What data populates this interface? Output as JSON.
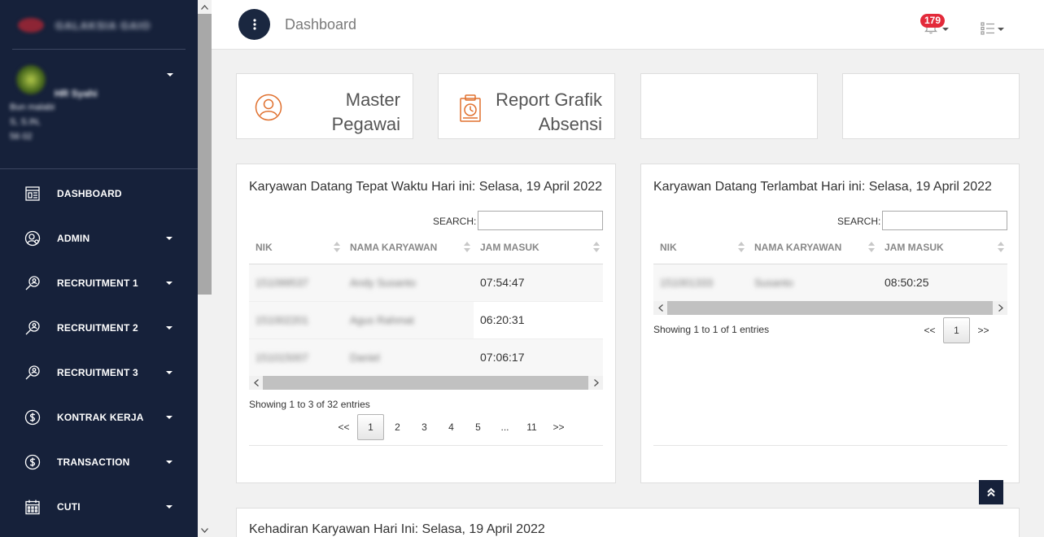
{
  "sidebar": {
    "brand": "GALAKSIA GAIO",
    "profile": {
      "name": "HR Syahi",
      "lines": [
        "Bun malabi",
        "S, S.IN,",
        "56 02"
      ]
    },
    "menu": [
      {
        "label": "DASHBOARD",
        "icon": "dashboard-icon",
        "has_caret": false
      },
      {
        "label": "ADMIN",
        "icon": "user-gear-icon",
        "has_caret": true
      },
      {
        "label": "RECRUITMENT 1",
        "icon": "search-user-icon",
        "has_caret": true
      },
      {
        "label": "RECRUITMENT 2",
        "icon": "search-user-icon",
        "has_caret": true
      },
      {
        "label": "RECRUITMENT 3",
        "icon": "search-user-icon",
        "has_caret": true
      },
      {
        "label": "KONTRAK KERJA",
        "icon": "dollar-icon",
        "has_caret": true
      },
      {
        "label": "TRANSACTION",
        "icon": "dollar-icon",
        "has_caret": true
      },
      {
        "label": "CUTI",
        "icon": "calendar-icon",
        "has_caret": true
      }
    ]
  },
  "header": {
    "title": "Dashboard",
    "notification_count": "179"
  },
  "quick_cards": [
    {
      "label_line1": "Master",
      "label_line2": "Pegawai",
      "icon": "user-circle-icon"
    },
    {
      "label_line1": "Report Grafik",
      "label_line2": "Absensi",
      "icon": "report-clock-icon"
    },
    {
      "label_line1": "",
      "label_line2": "",
      "icon": ""
    },
    {
      "label_line1": "",
      "label_line2": "",
      "icon": ""
    }
  ],
  "panel_ontime": {
    "title": "Karyawan Datang Tepat Waktu Hari ini: Selasa, 19 April 2022",
    "search_label": "SEARCH:",
    "columns": [
      "NIK",
      "NAMA KARYAWAN",
      "JAM MASUK"
    ],
    "rows": [
      {
        "nik": "151099537",
        "nama": "Andy Susanto",
        "jam": "07:54:47"
      },
      {
        "nik": "151002201",
        "nama": "Agus Rahmat",
        "jam": "06:20:31"
      },
      {
        "nik": "151015007",
        "nama": "Daniel",
        "jam": "07:06:17"
      }
    ],
    "info": "Showing 1 to 3 of 32 entries",
    "pages": [
      "<<",
      "1",
      "2",
      "3",
      "4",
      "5",
      "...",
      "11",
      ">>"
    ],
    "active_page": "1"
  },
  "panel_late": {
    "title": "Karyawan Datang Terlambat Hari ini: Selasa, 19 April 2022",
    "search_label": "SEARCH:",
    "columns": [
      "NIK",
      "NAMA KARYAWAN",
      "JAM MASUK"
    ],
    "rows": [
      {
        "nik": "151001333",
        "nama": "Susanto",
        "jam": "08:50:25"
      }
    ],
    "info": "Showing 1 to 1 of 1 entries",
    "pages": [
      "<<",
      "1",
      ">>"
    ],
    "active_page": "1"
  },
  "panel_attendance": {
    "title": "Kehadiran Karyawan Hari Ini: Selasa, 19 April 2022"
  },
  "colors": {
    "sidebar_bg": "#16213a",
    "accent_orange": "#e0702e",
    "badge_red": "#e32a3a"
  }
}
